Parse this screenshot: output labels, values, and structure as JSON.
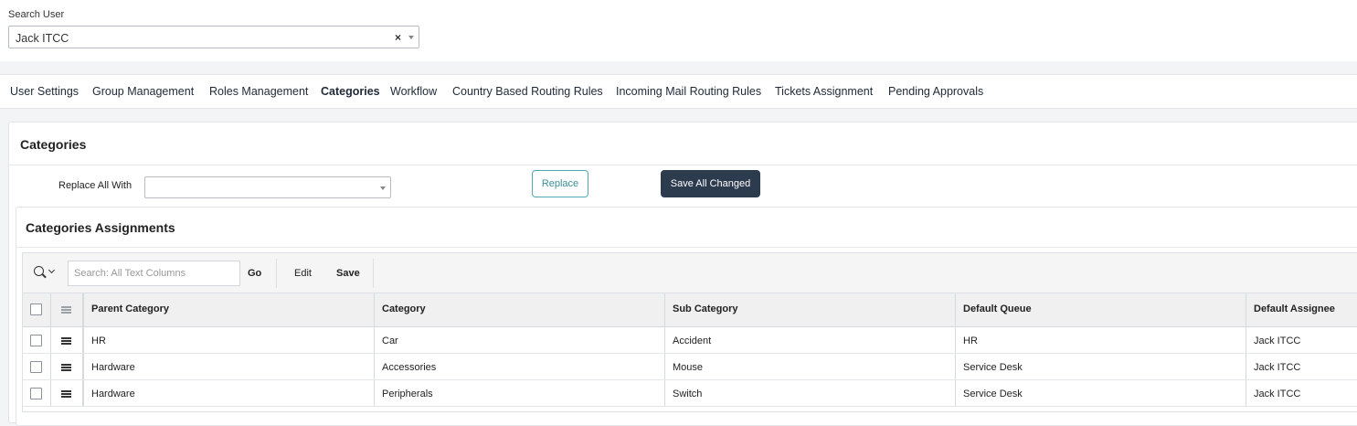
{
  "search_user": {
    "label": "Search User",
    "value": "Jack ITCC",
    "clear": "×"
  },
  "tabs": [
    {
      "label": "User Settings",
      "active": false
    },
    {
      "label": "Group Management",
      "active": false
    },
    {
      "label": "Roles Management",
      "active": false
    },
    {
      "label": "Categories",
      "active": true
    },
    {
      "label": "Workflow",
      "active": false
    },
    {
      "label": "Country Based Routing Rules",
      "active": false
    },
    {
      "label": "Incoming Mail Routing Rules",
      "active": false
    },
    {
      "label": "Tickets Assignment",
      "active": false
    },
    {
      "label": "Pending Approvals",
      "active": false
    }
  ],
  "categories_panel": {
    "title": "Categories",
    "replace_label": "Replace All With",
    "replace_value": "",
    "replace_button": "Replace",
    "save_all_button": "Save All Changed"
  },
  "assignments": {
    "title": "Categories Assignments",
    "search_placeholder": "Search: All Text Columns",
    "go_label": "Go",
    "edit_label": "Edit",
    "save_label": "Save",
    "columns": [
      "Parent Category",
      "Category",
      "Sub Category",
      "Default Queue",
      "Default Assignee"
    ],
    "rows": [
      [
        "HR",
        "Car",
        "Accident",
        "HR",
        "Jack ITCC"
      ],
      [
        "Hardware",
        "Accessories",
        "Mouse",
        "Service Desk",
        "Jack ITCC"
      ],
      [
        "Hardware",
        "Peripherals",
        "Switch",
        "Service Desk",
        "Jack ITCC"
      ]
    ]
  },
  "colors": {
    "primary_dark": "#2d3b4f",
    "accent_teal": "#3a8f98"
  }
}
